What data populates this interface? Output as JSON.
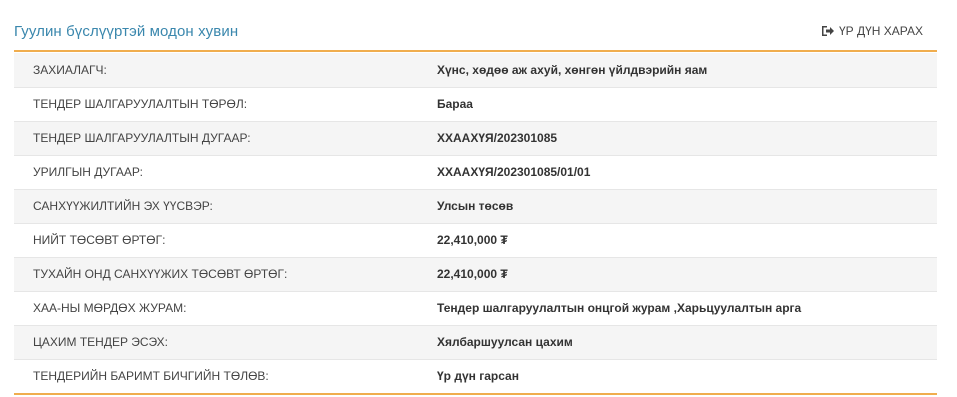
{
  "panel": {
    "title": "Гуулин бүслүүртэй модон хувин",
    "result_link_label": "ҮР ДҮН ХАРАХ",
    "result_icon": "sign-out-icon",
    "accent_color": "#f0ad4e",
    "title_color": "#3a87ad"
  },
  "rows": [
    {
      "label": "ЗАХИАЛАГЧ:",
      "value": "Хүнс, хөдөө аж ахуй, хөнгөн үйлдвэрийн яам"
    },
    {
      "label": "ТЕНДЕР ШАЛГАРУУЛАЛТЫН ТӨРӨЛ:",
      "value": "Бараа"
    },
    {
      "label": "ТЕНДЕР ШАЛГАРУУЛАЛТЫН ДУГААР:",
      "value": "ХХААХҮЯ/202301085"
    },
    {
      "label": "УРИЛГЫН ДУГААР:",
      "value": "ХХААХҮЯ/202301085/01/01"
    },
    {
      "label": "САНХҮҮЖИЛТИЙН ЭХ ҮҮСВЭР:",
      "value": "Улсын төсөв"
    },
    {
      "label": "НИЙТ ТӨСӨВТ ӨРТӨГ:",
      "value": "22,410,000 ₮"
    },
    {
      "label": "ТУХАЙН ОНД САНХҮҮЖИХ ТӨСӨВТ ӨРТӨГ:",
      "value": "22,410,000 ₮"
    },
    {
      "label": "ХАА-НЫ МӨРДӨХ ЖУРАМ:",
      "value": "Тендер шалгаруулалтын онцгой журам ,Харьцуулалтын арга"
    },
    {
      "label": "ЦАХИМ ТЕНДЕР ЭСЭХ:",
      "value": "Хялбаршуулсан цахим"
    },
    {
      "label": "ТЕНДЕРИЙН БАРИМТ БИЧГИЙН ТӨЛӨВ:",
      "value": "Үр дүн гарсан"
    }
  ]
}
